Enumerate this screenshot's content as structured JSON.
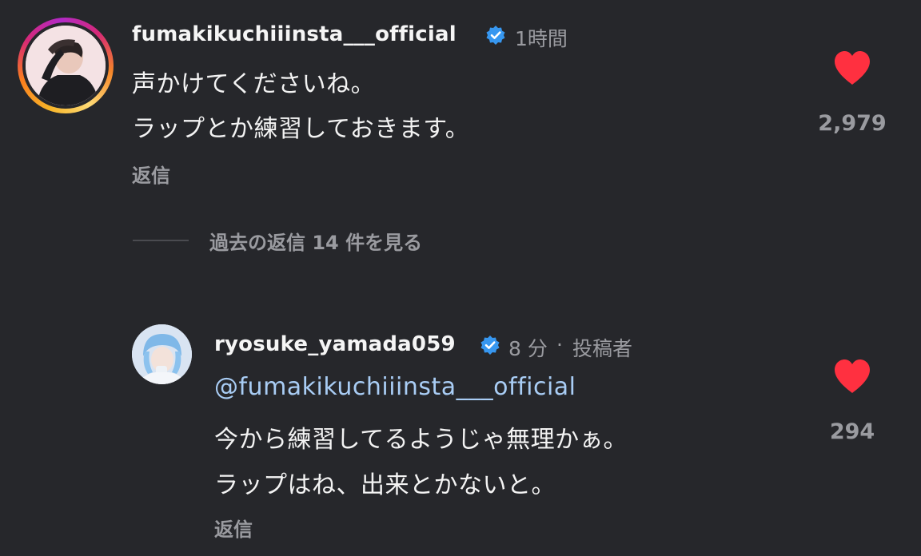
{
  "comments": [
    {
      "username": "fumakikuchiiinsta___official",
      "time": "1時間",
      "lines": [
        "声かけてくださいね。",
        "ラップとか練習しておきます。"
      ],
      "reply_label": "返信",
      "likes": "2,979"
    },
    {
      "username": "ryosuke_yamada059",
      "time": "8 分",
      "separator": "·",
      "author_label": "投稿者",
      "mention": "@fumakikuchiiinsta___official",
      "lines": [
        "今から練習してるようじゃ無理かぁ。",
        "ラップはね、出来とかないと。"
      ],
      "reply_label": "返信",
      "likes": "294"
    }
  ],
  "view_replies": "過去の返信 14 件を見る",
  "colors": {
    "background": "#26272b",
    "heart": "#ff3040",
    "verified": "#3797f0",
    "mention": "#a9cdf5",
    "muted": "#9a9ba0"
  },
  "icons": [
    "verified-badge-icon",
    "heart-icon"
  ]
}
